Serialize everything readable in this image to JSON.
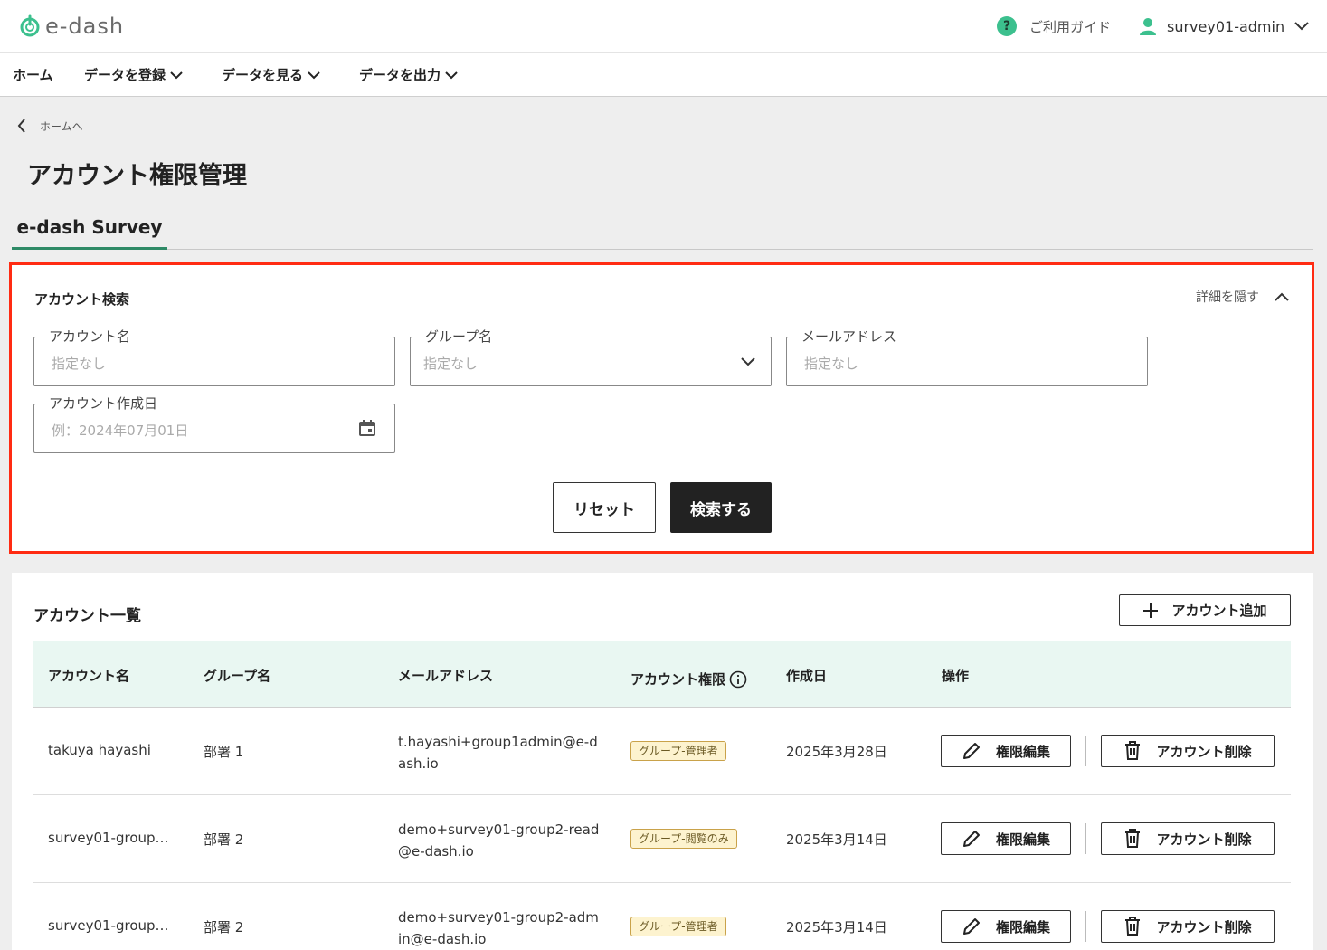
{
  "header": {
    "logo_text": "e-dash",
    "help_label": "ご利用ガイド",
    "help_icon_glyph": "?",
    "user_name": "survey01-admin"
  },
  "nav": {
    "home": "ホーム",
    "register": "データを登録",
    "view": "データを見る",
    "export": "データを出力"
  },
  "breadcrumb": {
    "back_label": "ホームへ"
  },
  "page": {
    "title": "アカウント権限管理"
  },
  "tabs": {
    "active": "e-dash Survey"
  },
  "search": {
    "title": "アカウント検索",
    "toggle_label": "詳細を隠す",
    "fields": {
      "account_name": {
        "label": "アカウント名",
        "placeholder": "指定なし"
      },
      "group_name": {
        "label": "グループ名",
        "placeholder": "指定なし"
      },
      "email": {
        "label": "メールアドレス",
        "placeholder": "指定なし"
      },
      "created_date": {
        "label": "アカウント作成日",
        "placeholder": "例：2024年07月01日"
      }
    },
    "reset_label": "リセット",
    "submit_label": "検索する"
  },
  "list": {
    "title": "アカウント一覧",
    "add_label": "アカウント追加",
    "columns": {
      "name": "アカウント名",
      "group": "グループ名",
      "email": "メールアドレス",
      "role": "アカウント権限",
      "created": "作成日",
      "actions": "操作"
    },
    "edit_label": "権限編集",
    "delete_label": "アカウント削除",
    "rows": [
      {
        "name": "takuya hayashi",
        "group": "部署 1",
        "email": "t.hayashi+group1admin@e-dash.io",
        "role": "グループ-管理者",
        "created": "2025年3月28日"
      },
      {
        "name": "survey01-group…",
        "group": "部署 2",
        "email": "demo+survey01-group2-read@e-dash.io",
        "role": "グループ-閲覧のみ",
        "created": "2025年3月14日"
      },
      {
        "name": "survey01-group…",
        "group": "部署 2",
        "email": "demo+survey01-group2-admin@e-dash.io",
        "role": "グループ-管理者",
        "created": "2025年3月14日"
      }
    ]
  },
  "colors": {
    "accent": "#3cc08e",
    "tab_underline": "#2e8a66",
    "highlight_border": "#ff2b12",
    "table_header_bg": "#e9f7f2",
    "badge_bg": "#fdf3cf",
    "badge_border": "#c9a24a"
  },
  "icons": {
    "logo": "power-icon",
    "help": "help-circle-icon",
    "user": "user-icon",
    "chevron": "chevron-down-icon",
    "back": "chevron-left-icon",
    "collapse": "chevron-up-icon",
    "calendar": "calendar-icon",
    "add": "plus-icon",
    "info": "info-icon",
    "edit": "pencil-icon",
    "delete": "trash-icon"
  }
}
